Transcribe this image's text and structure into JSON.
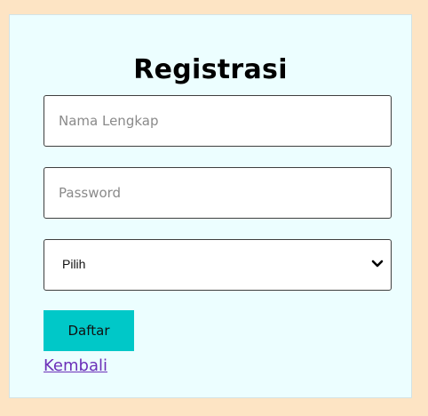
{
  "form": {
    "title": "Registrasi",
    "name_placeholder": "Nama Lengkap",
    "password_placeholder": "Password",
    "select_value": "Pilih",
    "submit_label": "Daftar",
    "back_link": "Kembali"
  },
  "colors": {
    "page_background": "#fde4c4",
    "card_background": "#ecfeff",
    "button": "#00c8c8",
    "link": "#6b2fb8"
  },
  "icons": {
    "select_arrow": "chevron-down-icon"
  }
}
